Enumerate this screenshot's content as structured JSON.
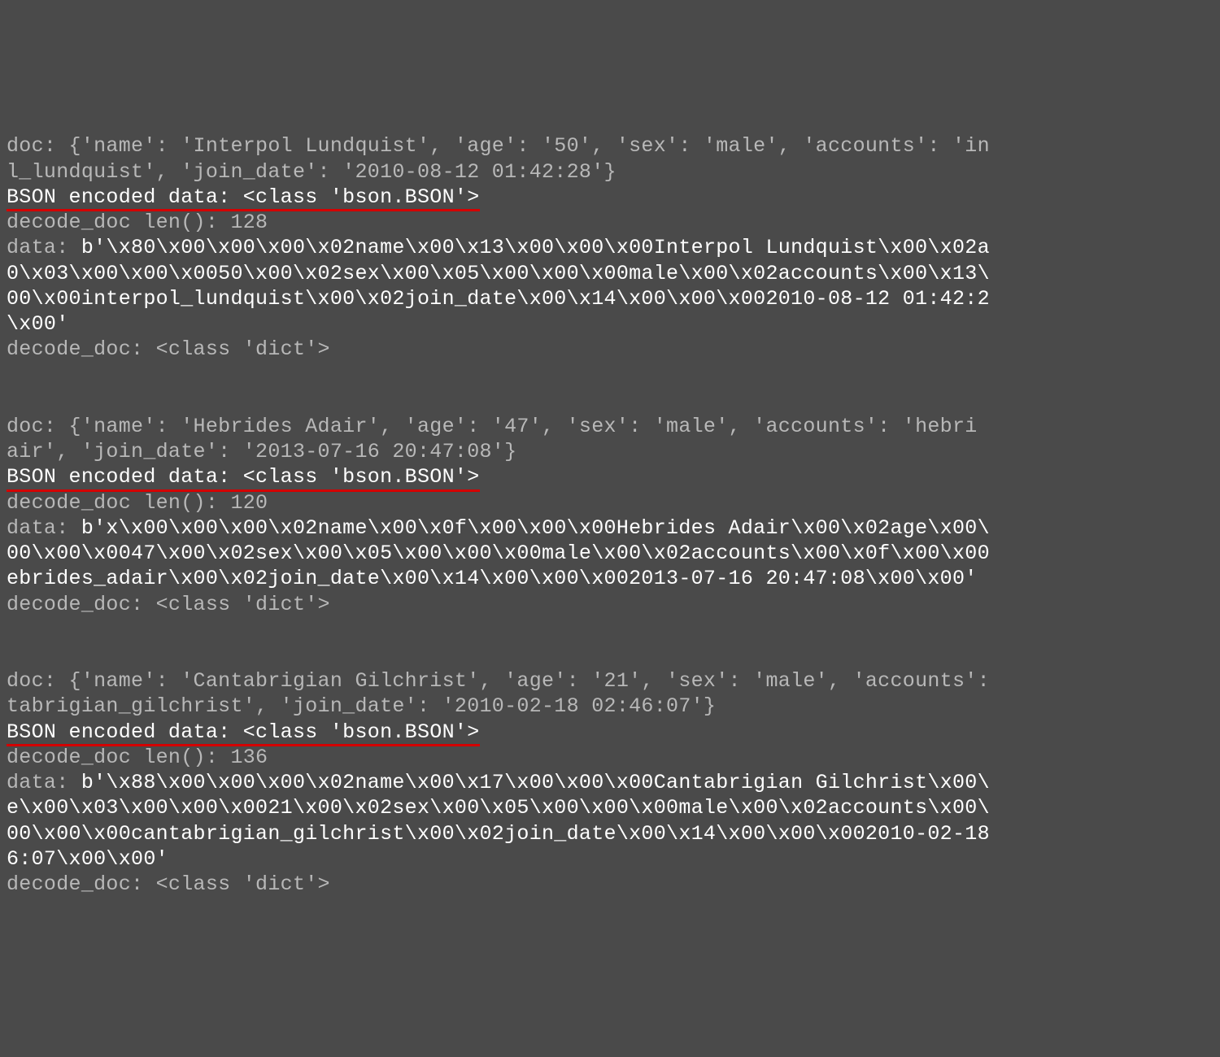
{
  "entries": [
    {
      "doc_line1": "doc: {'name': 'Interpol Lundquist', 'age': '50', 'sex': 'male', 'accounts': 'in",
      "doc_line2": "l_lundquist', 'join_date': '2010-08-12 01:42:28'}",
      "bson_label": "BSON encoded data: <class 'bson.BSON'>",
      "decode_len": "decode_doc len(): 128",
      "data_prefix": "data: ",
      "data_line1": "b'\\x80\\x00\\x00\\x00\\x02name\\x00\\x13\\x00\\x00\\x00Interpol Lundquist\\x00\\x02a",
      "data_line2": "0\\x03\\x00\\x00\\x0050\\x00\\x02sex\\x00\\x05\\x00\\x00\\x00male\\x00\\x02accounts\\x00\\x13\\",
      "data_line3": "00\\x00interpol_lundquist\\x00\\x02join_date\\x00\\x14\\x00\\x00\\x002010-08-12 01:42:2",
      "data_line4": "\\x00'",
      "decode_doc": "decode_doc: <class 'dict'>"
    },
    {
      "doc_line1": "doc: {'name': 'Hebrides Adair', 'age': '47', 'sex': 'male', 'accounts': 'hebri",
      "doc_line2": "air', 'join_date': '2013-07-16 20:47:08'}",
      "bson_label": "BSON encoded data: <class 'bson.BSON'>",
      "decode_len": "decode_doc len(): 120",
      "data_prefix": "data: ",
      "data_line1": "b'x\\x00\\x00\\x00\\x02name\\x00\\x0f\\x00\\x00\\x00Hebrides Adair\\x00\\x02age\\x00\\",
      "data_line2": "00\\x00\\x0047\\x00\\x02sex\\x00\\x05\\x00\\x00\\x00male\\x00\\x02accounts\\x00\\x0f\\x00\\x00",
      "data_line3": "ebrides_adair\\x00\\x02join_date\\x00\\x14\\x00\\x00\\x002013-07-16 20:47:08\\x00\\x00'",
      "data_line4": "",
      "decode_doc": "decode_doc: <class 'dict'>"
    },
    {
      "doc_line1": "doc: {'name': 'Cantabrigian Gilchrist', 'age': '21', 'sex': 'male', 'accounts':",
      "doc_line2": "tabrigian_gilchrist', 'join_date': '2010-02-18 02:46:07'}",
      "bson_label": "BSON encoded data: <class 'bson.BSON'>",
      "decode_len": "decode_doc len(): 136",
      "data_prefix": "data: ",
      "data_line1": "b'\\x88\\x00\\x00\\x00\\x02name\\x00\\x17\\x00\\x00\\x00Cantabrigian Gilchrist\\x00\\",
      "data_line2": "e\\x00\\x03\\x00\\x00\\x0021\\x00\\x02sex\\x00\\x05\\x00\\x00\\x00male\\x00\\x02accounts\\x00\\",
      "data_line3": "00\\x00\\x00cantabrigian_gilchrist\\x00\\x02join_date\\x00\\x14\\x00\\x00\\x002010-02-18",
      "data_line4": "6:07\\x00\\x00'",
      "decode_doc": "decode_doc: <class 'dict'>"
    }
  ]
}
